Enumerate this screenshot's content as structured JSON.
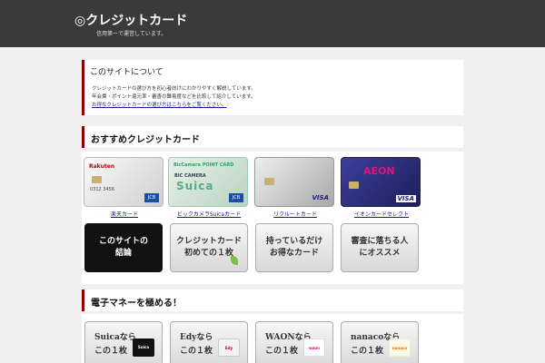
{
  "header": {
    "title": "◎クレジットカード",
    "tagline": "信用第一で運営しています。"
  },
  "notice": {
    "title": "このサイトについて",
    "lines": [
      "クレジットカードの選び方を初心者向けにわかりやすく解説しています。",
      "年会費・ポイント還元率・審査の難易度などを比較して紹介しています。",
      "お得なクレジットカードの選び方はこちらをご覧ください。"
    ]
  },
  "recommend": {
    "heading": "おすすめクレジットカード",
    "cards": [
      {
        "caption": "楽天カード",
        "logo": "Rakuten",
        "number": "0312 3456",
        "brand": "JCB"
      },
      {
        "caption": "ビックカメラSuicaカード",
        "top": "BicCamera POINT CARD",
        "mid": "BIC CAMERA",
        "suica": "Suica",
        "brand": "JCB"
      },
      {
        "caption": "リクルートカード",
        "brand": "VISA"
      },
      {
        "caption": "イオンカードセレクト",
        "logo": "AEON",
        "brand": "VISA"
      }
    ],
    "tiles": [
      {
        "line1": "このサイトの",
        "line2": "結論"
      },
      {
        "line1": "クレジットカード",
        "line2": "初めての１枚"
      },
      {
        "line1": "持っているだけ",
        "line2": "お得なカード"
      },
      {
        "line1": "審査に落ちる人",
        "line2": "にオススメ"
      }
    ]
  },
  "emoney": {
    "heading": "電子マネーを極める！",
    "tiles": [
      {
        "line1": "Suicaなら",
        "line2": "この１枚",
        "logo": "Suica",
        "logo_bg": "#111111",
        "logo_fg": "#ffffff"
      },
      {
        "line1": "Edyなら",
        "line2": "この１枚",
        "logo": "Edy",
        "logo_bg": "#f3f3f3",
        "logo_fg": "#c0002b"
      },
      {
        "line1": "WAONなら",
        "line2": "この１枚",
        "logo": "waon",
        "logo_bg": "#ffffff",
        "logo_fg": "#e4007f"
      },
      {
        "line1": "nanacoなら",
        "line2": "この１枚",
        "logo": "nanaco",
        "logo_bg": "#fff7e6",
        "logo_fg": "#e07000"
      }
    ]
  },
  "colors": {
    "header_bg": "#3a3a3a",
    "accent": "#8b0000",
    "link": "#1a1a99",
    "page_bg": "#f0f0f0"
  }
}
